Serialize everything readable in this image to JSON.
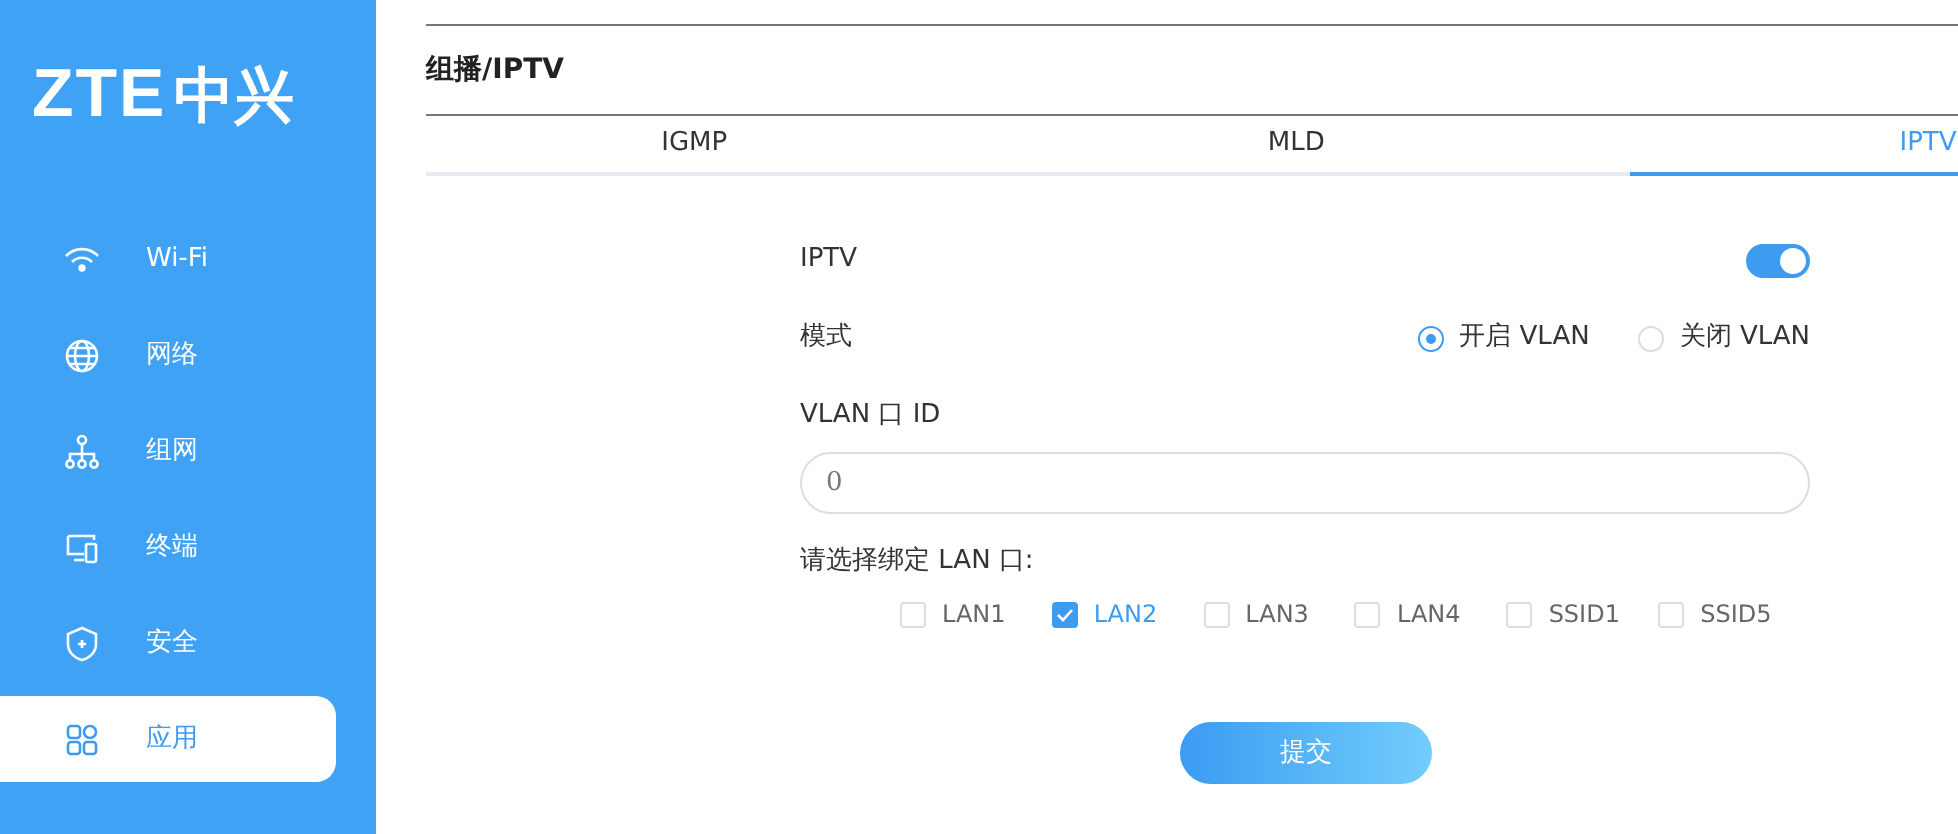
{
  "logo": {
    "latin": "ZTE",
    "chinese": "中兴"
  },
  "sidebar": {
    "items": [
      {
        "kind": "wifi",
        "label": "Wi-Fi",
        "selected": false
      },
      {
        "kind": "globe",
        "label": "网络",
        "selected": false
      },
      {
        "kind": "mesh",
        "label": "组网",
        "selected": false
      },
      {
        "kind": "devices",
        "label": "终端",
        "selected": false
      },
      {
        "kind": "shield",
        "label": "安全",
        "selected": false
      },
      {
        "kind": "apps",
        "label": "应用",
        "selected": true
      }
    ]
  },
  "page_title": "组播/IPTV",
  "tabs": [
    {
      "label": "IGMP",
      "selected": false
    },
    {
      "label": "MLD",
      "selected": false
    },
    {
      "label": "IPTV",
      "selected": true
    }
  ],
  "form": {
    "iptv": {
      "label": "IPTV",
      "on": true
    },
    "mode": {
      "label": "模式",
      "options": [
        {
          "label": "开启 VLAN",
          "selected": true
        },
        {
          "label": "关闭 VLAN",
          "selected": false
        }
      ]
    },
    "vlan_id": {
      "label": "VLAN 口 ID",
      "value": "0"
    },
    "lan_bind": {
      "label": "请选择绑定 LAN 口:",
      "options": [
        {
          "label": "LAN1",
          "checked": false
        },
        {
          "label": "LAN2",
          "checked": true
        },
        {
          "label": "LAN3",
          "checked": false
        },
        {
          "label": "LAN4",
          "checked": false
        },
        {
          "label": "SSID1",
          "checked": false
        },
        {
          "label": "SSID5",
          "checked": false
        }
      ]
    },
    "submit": "提交"
  }
}
